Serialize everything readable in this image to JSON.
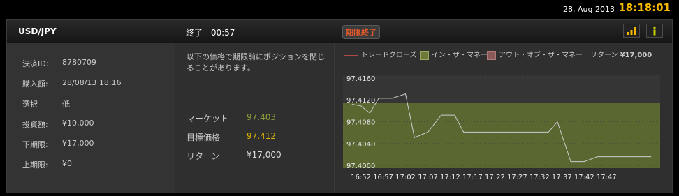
{
  "topbar": {
    "date": "28, Aug 2013",
    "time": "18:18:01"
  },
  "header": {
    "pair": "USD/JPY",
    "status_label": "終了",
    "status_time": "00:57",
    "expired_badge": "期限終了"
  },
  "details": [
    {
      "label": "決済ID:",
      "value": "8780709"
    },
    {
      "label": "購入額:",
      "value": "28/08/13 18:16"
    },
    {
      "label": "選択",
      "value": "低"
    },
    {
      "label": "投資額:",
      "value": "¥10,000"
    },
    {
      "label": "下期限:",
      "value": "¥17,000"
    },
    {
      "label": "上期限:",
      "value": "¥0"
    }
  ],
  "middle": {
    "note": "以下の価格で期限前にポジションを閉じることがあります。",
    "market_label": "マーケット",
    "market_value": "97.403",
    "target_label": "目標価格",
    "target_value": "97.412",
    "return_label": "リターン",
    "return_value": "¥17,000"
  },
  "legend": {
    "trade_close": "トレードクローズ",
    "in_money": "イン・ザ・マネー",
    "out_money": "アウト・オブ・ザ・マネー",
    "return_label": "リターン",
    "return_value": "¥17,000"
  },
  "colors": {
    "accent": "#f5b800",
    "in_money": "#6b7a3a",
    "out_money": "#8a5a5a",
    "line": "#cccccc",
    "expired": "#e85a2a"
  },
  "chart_data": {
    "type": "line",
    "x_ticks": [
      "16:52",
      "16:57",
      "17:02",
      "17:07",
      "17:12",
      "17:17",
      "17:22",
      "17:27",
      "17:32",
      "17:37",
      "17:42",
      "17:47"
    ],
    "y_ticks": [
      "97.4160",
      "97.4120",
      "97.4080",
      "97.4040",
      "97.4000"
    ],
    "ylim": [
      97.3995,
      97.4165
    ],
    "target": 97.412,
    "in_the_money_range": [
      97.3995,
      97.4115
    ],
    "x": [
      "16:50",
      "16:52",
      "16:54",
      "16:56",
      "16:59",
      "17:02",
      "17:04",
      "17:07",
      "17:10",
      "17:13",
      "17:15",
      "17:20",
      "17:25",
      "17:30",
      "17:34",
      "17:36",
      "17:39",
      "17:42",
      "17:45",
      "17:50",
      "17:57"
    ],
    "y": [
      97.4112,
      97.4109,
      97.4096,
      97.4123,
      97.4123,
      97.4131,
      97.4051,
      97.4061,
      97.4092,
      97.4092,
      97.4061,
      97.4061,
      97.4061,
      97.4061,
      97.4061,
      97.408,
      97.4007,
      97.4007,
      97.4016,
      97.4016,
      97.4016
    ]
  }
}
